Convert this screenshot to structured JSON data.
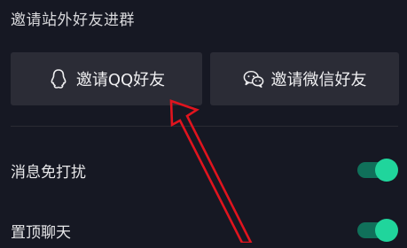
{
  "section": {
    "title": "邀请站外好友进群"
  },
  "buttons": {
    "qq": {
      "label": "邀请QQ好友",
      "icon": "qq-icon"
    },
    "wechat": {
      "label": "邀请微信好友",
      "icon": "wechat-icon"
    }
  },
  "settings": [
    {
      "label": "消息免打扰",
      "enabled": true
    },
    {
      "label": "置顶聊天",
      "enabled": true
    }
  ],
  "colors": {
    "background": "#161823",
    "button": "#2b2c36",
    "toggle_on": "#20d59c",
    "annotation": "#e0141e"
  }
}
